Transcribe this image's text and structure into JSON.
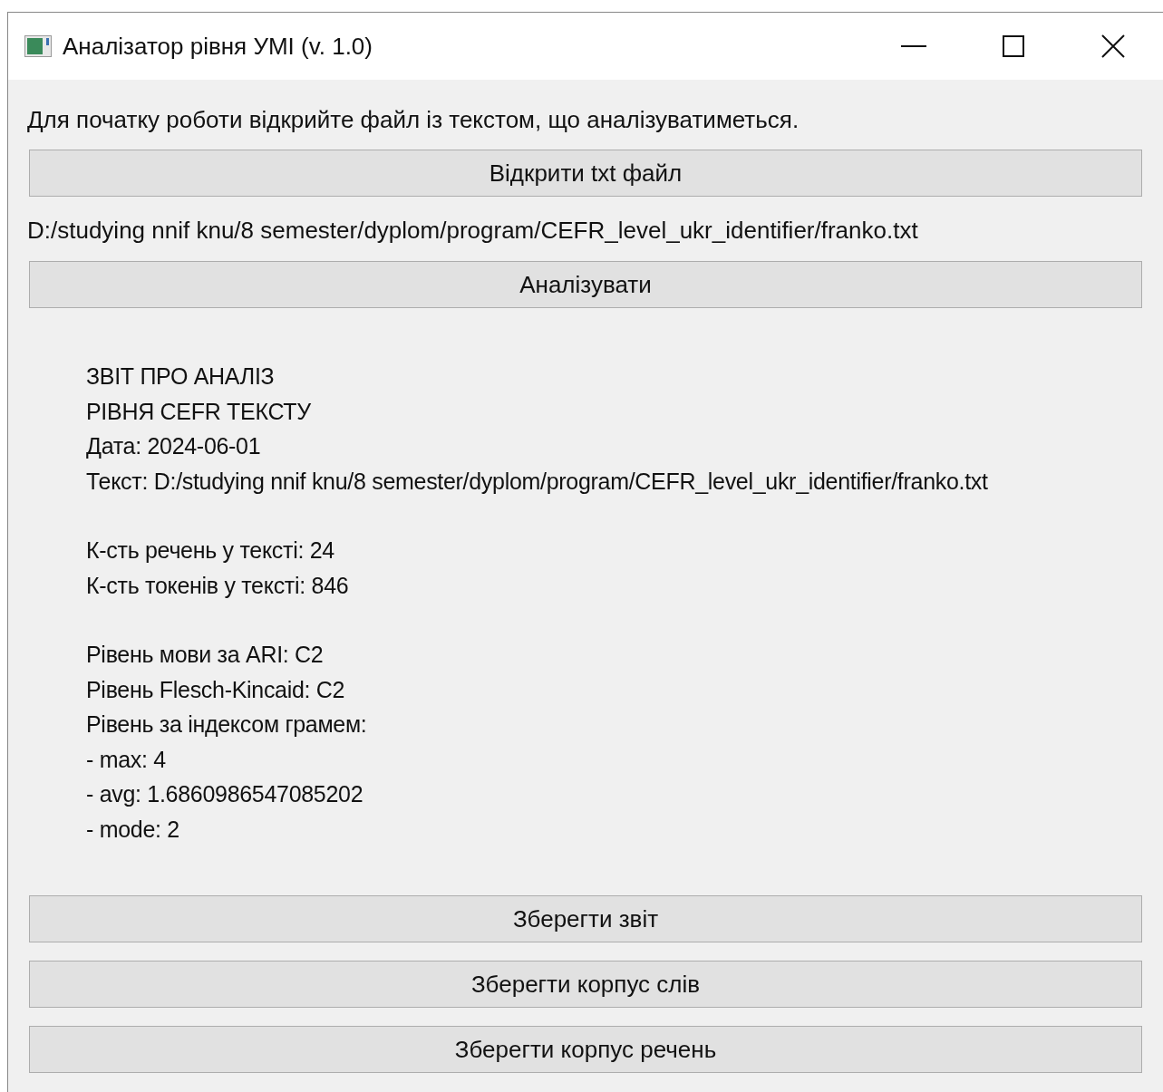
{
  "window": {
    "title": "Аналізатор рівня УМІ (v. 1.0)"
  },
  "instruction": "Для початку роботи відкрийте файл із текстом, що аналізуватиметься.",
  "open_button": "Відкрити txt файл",
  "file_path": "D:/studying nnif knu/8 semester/dyplom/program/CEFR_level_ukr_identifier/franko.txt",
  "analyze_button": "Аналізувати",
  "report": [
    [
      "ЗВІТ ПРО АНАЛІЗ",
      "РІВНЯ CEFR ТЕКСТУ",
      "Дата: 2024-06-01",
      "Текст: D:/studying nnif knu/8 semester/dyplom/program/CEFR_level_ukr_identifier/franko.txt"
    ],
    [
      "К-сть речень у тексті: 24",
      "К-сть токенів у тексті: 846"
    ],
    [
      "Рівень мови за ARI: C2",
      "Рівень Flesch-Kincaid: C2",
      "Рівень за індексом грамем:",
      "- max: 4",
      "- avg: 1.6860986547085202",
      "- mode: 2"
    ]
  ],
  "save_buttons": [
    "Зберегти звіт",
    "Зберегти корпус слів",
    "Зберегти корпус речень"
  ]
}
